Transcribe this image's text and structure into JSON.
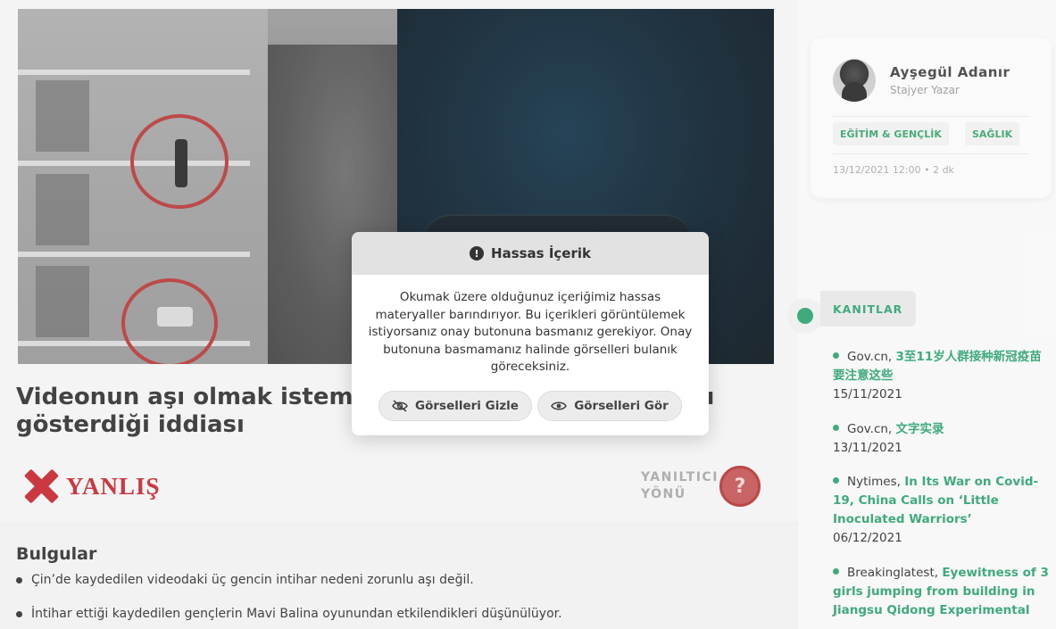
{
  "article": {
    "title": "Videonun aşı olmak istemeyen gençlerin intihar anını gösterdiği iddiası",
    "verdict": "YANLIŞ",
    "category_line1": "YANILTICI",
    "category_line2": "YÖNÜ",
    "category_icon": "question-mask-icon"
  },
  "findings": {
    "title": "Bulgular",
    "items": [
      "Çin’de kaydedilen videodaki üç gencin intihar nedeni zorunlu aşı değil.",
      "İntihar ettiği kaydedilen gençlerin Mavi Balina oyunundan etkilendikleri düşünülüyor."
    ]
  },
  "author": {
    "name": "Ayşegül Adanır",
    "role": "Stajyer Yazar",
    "tags": [
      "EĞİTİM & GENÇLİK",
      "SAĞLIK"
    ],
    "meta": "13/12/2021 12:00 • 2 dk"
  },
  "evidence": {
    "label": "KANITLAR",
    "items": [
      {
        "source": "Gov.cn,",
        "link": "3至11岁人群接种新冠疫苗要注意这些",
        "date": "15/11/2021"
      },
      {
        "source": "Gov.cn,",
        "link": "文字实录",
        "date": "13/11/2021"
      },
      {
        "source": "Nytimes,",
        "link": "In Its War on Covid-19, China Calls on ‘Little Inoculated Warriors’",
        "date": "06/12/2021"
      },
      {
        "source": "Breakinglatest,",
        "link": "Eyewitness of 3 girls jumping from building in Jiangsu Qidong Experimental",
        "date": ""
      }
    ]
  },
  "modal": {
    "title": "Hassas İçerik",
    "body": "Okumak üzere olduğunuz içeriğimiz hassas materyaller barındırıyor. Bu içerikleri görüntülemek istiyorsanız onay butonuna basmanız gerekiyor. Onay butonuna basmamanız halinde görselleri bulanık göreceksiniz.",
    "hide_label": "Görselleri Gizle",
    "show_label": "Görselleri Gör"
  },
  "colors": {
    "accent_green": "#2fa472",
    "verdict_red": "#c8282f"
  }
}
